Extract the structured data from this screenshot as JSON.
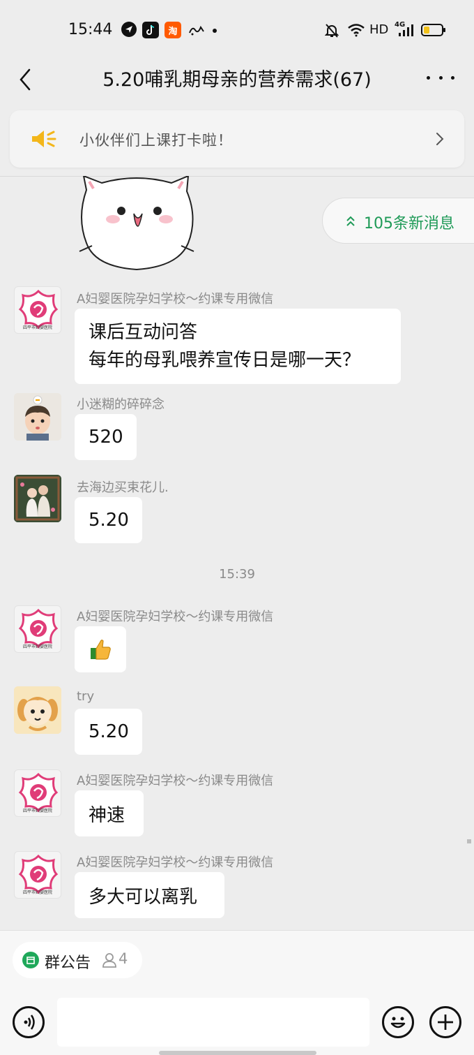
{
  "status_bar": {
    "time": "15:44",
    "app_icons": [
      "navigation-icon",
      "tiktok-icon",
      "taobao-icon",
      "app-icon"
    ],
    "taobao_label": "淘",
    "network_label": "HD",
    "signal_label": "4G",
    "battery_level": 0.35,
    "colors": {
      "taobao": "#ff5a00",
      "battery": "#f2c21b"
    }
  },
  "header": {
    "title": "5.20哺乳期母亲的营养需求(67)",
    "back_icon": "chevron-left-icon",
    "more_icon": "more-dots-icon"
  },
  "notice": {
    "text": "小伙伴们上课打卡啦！",
    "icon": "speaker-icon",
    "color": "#f3b61a"
  },
  "new_messages": {
    "label": "105条新消息",
    "color": "#1e9a57"
  },
  "time_separator": "15:39",
  "messages": [
    {
      "sender": "A妇婴医院孕妇学校～约课专用微信",
      "lines": [
        "课后互动问答",
        "每年的母乳喂养宣传日是哪一天？"
      ],
      "hospital_caption": "四平市妇婴医院"
    },
    {
      "sender": "小迷糊的碎碎念",
      "text": "520"
    },
    {
      "sender": "去海边买束花儿.",
      "text": "5.20"
    },
    {
      "sender": "A妇婴医院孕妇学校～约课专用微信",
      "emoji": "thumbs-up-icon",
      "hospital_caption": "四平市妇婴医院"
    },
    {
      "sender": "try",
      "text": "5.20"
    },
    {
      "sender": "A妇婴医院孕妇学校～约课专用微信",
      "text": "神速",
      "hospital_caption": "四平市妇婴医院"
    },
    {
      "sender": "A妇婴医院孕妇学校～约课专用微信",
      "text": "多大可以离乳",
      "hospital_caption": "四平市妇婴医院"
    }
  ],
  "bottom_bar": {
    "announcement_label": "群公告",
    "member_count": "4",
    "input_placeholder": "",
    "icons": [
      "voice-icon",
      "emoji-icon",
      "plus-icon"
    ],
    "accent": "#1fa85a"
  }
}
